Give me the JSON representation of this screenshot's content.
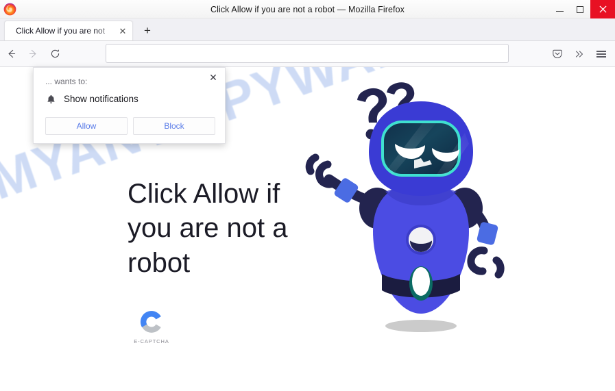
{
  "window": {
    "title": "Click Allow if you are not a robot — Mozilla Firefox",
    "minimize_label": "Minimize",
    "maximize_label": "Maximize",
    "close_label": "Close"
  },
  "tabs": {
    "items": [
      {
        "title": "Click Allow if you are not",
        "close_glyph": "✕"
      }
    ],
    "new_tab_glyph": "+"
  },
  "toolbar": {
    "back_glyph": "←",
    "forward_glyph": "→",
    "reload_glyph": "⟳",
    "url_value": "",
    "url_placeholder": "",
    "pocket_label": "Save to Pocket",
    "overflow_glyph": "»",
    "menu_label": "Open application menu"
  },
  "popup": {
    "host": "... wants to:",
    "permission": "Show notifications",
    "allow_label": "Allow",
    "block_label": "Block",
    "close_glyph": "✕"
  },
  "page": {
    "headline": "Click Allow if you are not a robot",
    "captcha_label": "E-CAPTCHA",
    "watermark": "MYANTISPYWARE.COM",
    "robot_question_marks": "??"
  },
  "colors": {
    "accent_blue": "#5a7ce8",
    "robot_body": "#4b4ce3",
    "robot_dark": "#1e1f45",
    "visor_outline": "#3fe0d0",
    "watermark": "#ccdaf5",
    "close_button": "#e81123",
    "captcha_blue": "#4285f4",
    "captcha_gray": "#bdc1c6"
  }
}
